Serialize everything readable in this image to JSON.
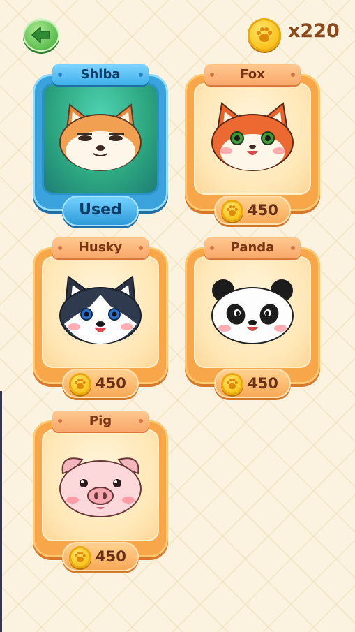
{
  "header": {
    "back_icon": "back-arrow-icon",
    "coin_icon": "paw-coin-icon",
    "coin_count": "x220"
  },
  "colors": {
    "selected_frame": "#3aa2dd",
    "card_frame": "#f8a64a",
    "text_brown": "#6a2f16"
  },
  "skins": [
    {
      "name": "Shiba",
      "status": "Used",
      "icon": "shiba-face-icon"
    },
    {
      "name": "Fox",
      "price": "450",
      "icon": "fox-face-icon"
    },
    {
      "name": "Husky",
      "price": "450",
      "icon": "husky-face-icon"
    },
    {
      "name": "Panda",
      "price": "450",
      "icon": "panda-face-icon"
    },
    {
      "name": "Pig",
      "price": "450",
      "icon": "pig-face-icon"
    }
  ]
}
